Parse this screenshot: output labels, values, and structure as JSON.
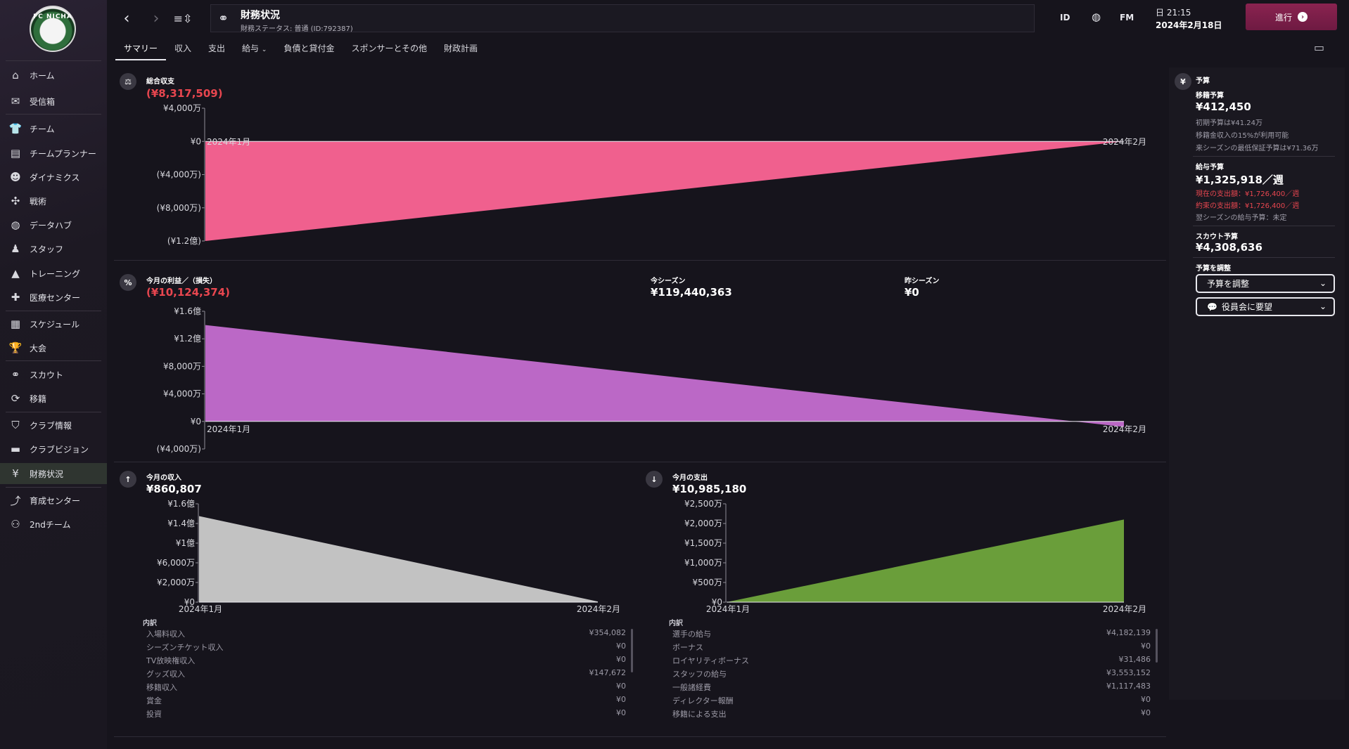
{
  "sidebar": {
    "logo_text": "FC NICHA",
    "items": [
      {
        "label": "ホーム",
        "icon": "home-icon"
      },
      {
        "label": "受信箱",
        "icon": "mail-icon"
      },
      {
        "label": "チーム",
        "icon": "shirt-icon"
      },
      {
        "label": "チームプランナー",
        "icon": "planner-icon"
      },
      {
        "label": "ダイナミクス",
        "icon": "dynamics-icon"
      },
      {
        "label": "戦術",
        "icon": "tactics-icon"
      },
      {
        "label": "データハブ",
        "icon": "datahub-icon"
      },
      {
        "label": "スタッフ",
        "icon": "staff-icon"
      },
      {
        "label": "トレーニング",
        "icon": "training-cone-icon"
      },
      {
        "label": "医療センター",
        "icon": "medical-icon"
      },
      {
        "label": "スケジュール",
        "icon": "calendar-icon"
      },
      {
        "label": "大会",
        "icon": "trophy-icon"
      },
      {
        "label": "スカウト",
        "icon": "binoculars-icon"
      },
      {
        "label": "移籍",
        "icon": "transfer-icon"
      },
      {
        "label": "クラブ情報",
        "icon": "shield-icon"
      },
      {
        "label": "クラブビジョン",
        "icon": "vision-icon"
      },
      {
        "label": "財務状況",
        "icon": "finance-icon"
      },
      {
        "label": "育成センター",
        "icon": "development-icon"
      },
      {
        "label": "2ndチーム",
        "icon": "second-team-icon"
      }
    ]
  },
  "header": {
    "title": "財務状況",
    "subtitle": "財務ステータス: 普通 (ID:792387)",
    "id_label": "ID",
    "fm_label": "FM",
    "time": "日 21:15",
    "date": "2024年2月18日",
    "continue_label": "進行"
  },
  "tabs": [
    "サマリー",
    "収入",
    "支出",
    "給与",
    "負債と貸付金",
    "スポンサーとその他",
    "財政計画"
  ],
  "overall": {
    "label": "総合収支",
    "value": "(¥8,317,509)"
  },
  "monthly": {
    "label": "今月の利益／（損失）",
    "value": "(¥10,124,374)",
    "this_season_label": "今シーズン",
    "this_season_value": "¥119,440,363",
    "last_season_label": "昨シーズン",
    "last_season_value": "¥0"
  },
  "income": {
    "label": "今月の収入",
    "value": "¥860,807",
    "breakdown_title": "内訳",
    "rows": [
      {
        "name": "入場料収入",
        "value": "¥354,082"
      },
      {
        "name": "シーズンチケット収入",
        "value": "¥0"
      },
      {
        "name": "TV放映権収入",
        "value": "¥0"
      },
      {
        "name": "グッズ収入",
        "value": "¥147,672"
      },
      {
        "name": "移籍収入",
        "value": "¥0"
      },
      {
        "name": "賞金",
        "value": "¥0"
      },
      {
        "name": "投資",
        "value": "¥0"
      }
    ]
  },
  "expense": {
    "label": "今月の支出",
    "value": "¥10,985,180",
    "breakdown_title": "内訳",
    "rows": [
      {
        "name": "選手の給与",
        "value": "¥4,182,139"
      },
      {
        "name": "ボーナス",
        "value": "¥0"
      },
      {
        "name": "ロイヤリティボーナス",
        "value": "¥31,486"
      },
      {
        "name": "スタッフの給与",
        "value": "¥3,553,152"
      },
      {
        "name": "一般諸経費",
        "value": "¥1,117,483"
      },
      {
        "name": "ディレクター報酬",
        "value": "¥0"
      },
      {
        "name": "移籍による支出",
        "value": "¥0"
      }
    ]
  },
  "budget": {
    "title": "予算",
    "transfer_label": "移籍予算",
    "transfer_value": "¥412,450",
    "transfer_notes": [
      "初期予算は¥41.24万",
      "移籍金収入の15%が利用可能",
      "来シーズンの最低保証予算は¥71.36万"
    ],
    "wage_label": "給与予算",
    "wage_value": "¥1,325,918／週",
    "wage_current": "現在の支出額：¥1,726,400／週",
    "wage_promised": "約束の支出額：¥1,726,400／週",
    "wage_next": "翌シーズンの給与予算：未定",
    "scout_label": "スカウト予算",
    "scout_value": "¥4,308,636",
    "adjust_label": "予算を調整",
    "adjust_dropdown": "予算を調整",
    "board_dropdown": "役員会に要望"
  },
  "chart_data": [
    {
      "type": "area",
      "x": [
        "2024年1月",
        "2024年2月"
      ],
      "series": [
        {
          "values": [
            -120000000,
            0
          ],
          "color": "#f0608e"
        }
      ],
      "yticks": [
        "¥4,000万",
        "¥0",
        "(¥4,000万)",
        "(¥8,000万)",
        "(¥1.2億)"
      ],
      "ylim": [
        -120000000,
        40000000
      ]
    },
    {
      "type": "area",
      "x": [
        "2024年1月",
        "2024年2月"
      ],
      "series": [
        {
          "values": [
            140000000,
            -8000000
          ],
          "color": "#bb68c6"
        }
      ],
      "yticks": [
        "¥1.6億",
        "¥1.2億",
        "¥8,000万",
        "¥4,000万",
        "¥0",
        "(¥4,000万)"
      ],
      "ylim": [
        -40000000,
        160000000
      ]
    },
    {
      "type": "area",
      "x": [
        "2024年1月",
        "2024年2月"
      ],
      "series": [
        {
          "values": [
            140000000,
            1000000
          ],
          "color": "#c2c2c2"
        }
      ],
      "yticks": [
        "¥1.6億",
        "¥1.4億",
        "¥1億",
        "¥6,000万",
        "¥2,000万",
        "¥0"
      ],
      "ylim": [
        0,
        160000000
      ]
    },
    {
      "type": "area",
      "x": [
        "2024年1月",
        "2024年2月"
      ],
      "series": [
        {
          "values": [
            0,
            21000000
          ],
          "color": "#6a9e3a"
        }
      ],
      "yticks": [
        "¥2,500万",
        "¥2,000万",
        "¥1,500万",
        "¥1,000万",
        "¥500万",
        "¥0"
      ],
      "ylim": [
        0,
        25000000
      ]
    }
  ]
}
